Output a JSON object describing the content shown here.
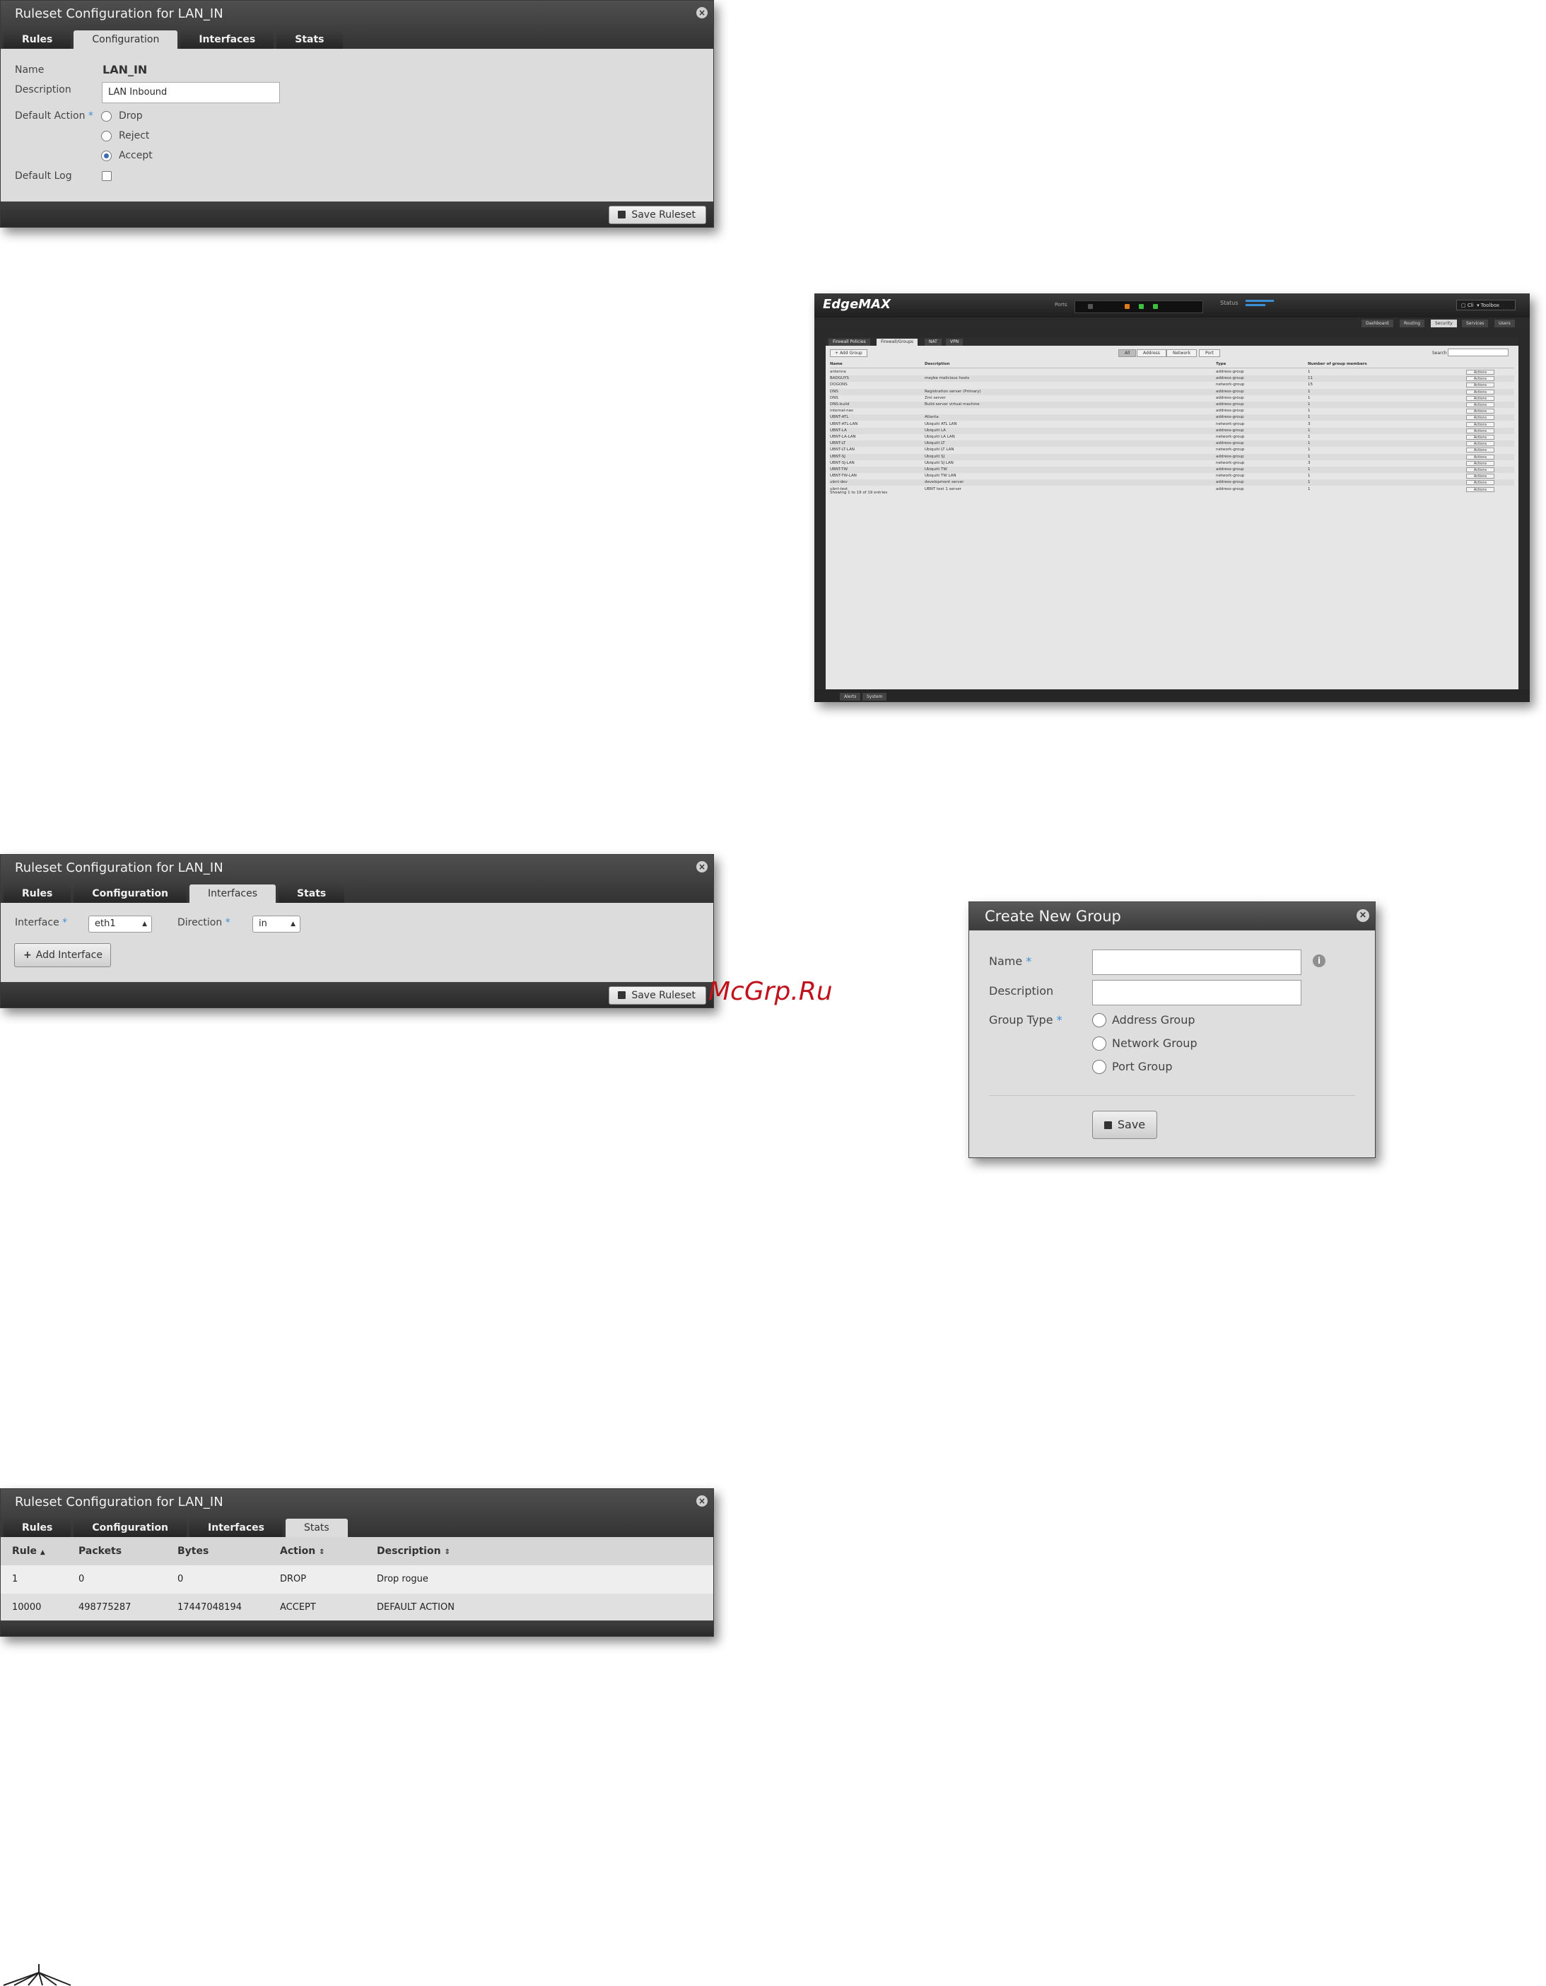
{
  "ruleset_title": "Ruleset Configuration for LAN_IN",
  "tabs": [
    "Rules",
    "Configuration",
    "Interfaces",
    "Stats"
  ],
  "save_ruleset_label": "Save Ruleset",
  "config": {
    "name_label": "Name",
    "name_value": "LAN_IN",
    "description_label": "Description",
    "description_value": "LAN Inbound",
    "default_action_label": "Default Action",
    "required_mark": "*",
    "actions": [
      "Drop",
      "Reject",
      "Accept"
    ],
    "selected_action": "Accept",
    "default_log_label": "Default Log"
  },
  "interfaces": {
    "interface_label": "Interface",
    "interface_value": "eth1",
    "direction_label": "Direction",
    "direction_value": "in",
    "add_interface_label": "Add Interface",
    "plus": "+"
  },
  "stats": {
    "columns": [
      "Rule",
      "Packets",
      "Bytes",
      "Action",
      "Description"
    ],
    "rows": [
      [
        "1",
        "0",
        "0",
        "DROP",
        "Drop rogue"
      ],
      [
        "10000",
        "498775287",
        "17447048194",
        "ACCEPT",
        "DEFAULT ACTION"
      ]
    ]
  },
  "create_group": {
    "title": "Create New Group",
    "name_label": "Name",
    "description_label": "Description",
    "group_type_label": "Group Type",
    "types": [
      "Address Group",
      "Network Group",
      "Port Group"
    ],
    "save_label": "Save",
    "required_mark": "*"
  },
  "edgemax": {
    "logo": "EdgeMAX",
    "ports_label": "Ports",
    "status_label": "Status",
    "nav_tabs": [
      "Dashboard",
      "Routing",
      "Security",
      "Services",
      "Users"
    ],
    "sub_tabs": [
      "Firewall Policies",
      "Firewall/Groups",
      "NAT",
      "VPN"
    ],
    "add_group": "Add Group",
    "filters": [
      "All",
      "Address",
      "Network",
      "Port"
    ],
    "search_label": "Search",
    "columns": [
      "Name",
      "Description",
      "Type",
      "Number of group members"
    ],
    "rows": [
      [
        "antenna",
        "",
        "address-group",
        "1"
      ],
      [
        "BADGUYS",
        "maybe malicious hosts",
        "address-group",
        "11"
      ],
      [
        "DOGONS",
        "",
        "network-group",
        "15"
      ],
      [
        "DNS",
        "Registration server (Primary)",
        "address-group",
        "1"
      ],
      [
        "DNS",
        "Zmi server",
        "address-group",
        "1"
      ],
      [
        "DNS-build",
        "Build server virtual machine",
        "address-group",
        "1"
      ],
      [
        "internal-nas",
        "",
        "address-group",
        "1"
      ],
      [
        "UBNT-ATL",
        "Atlanta",
        "address-group",
        "1"
      ],
      [
        "UBNT-ATL-LAN",
        "Ubiquiti ATL LAN",
        "network-group",
        "3"
      ],
      [
        "UBNT-LA",
        "Ubiquiti LA",
        "address-group",
        "1"
      ],
      [
        "UBNT-LA-LAN",
        "Ubiquiti LA LAN",
        "network-group",
        "1"
      ],
      [
        "UBNT-LT",
        "Ubiquiti LT",
        "address-group",
        "1"
      ],
      [
        "UBNT-LT-LAN",
        "Ubiquiti LT LAN",
        "network-group",
        "1"
      ],
      [
        "UBNT-SJ",
        "Ubiquiti SJ",
        "address-group",
        "1"
      ],
      [
        "UBNT-SJ-LAN",
        "Ubiquiti SJ LAN",
        "network-group",
        "3"
      ],
      [
        "UBNT-TW",
        "Ubiquiti TW",
        "address-group",
        "1"
      ],
      [
        "UBNT-TW-LAN",
        "Ubiquiti TW LAN",
        "network-group",
        "1"
      ],
      [
        "ubnt-dev",
        "development server",
        "address-group",
        "1"
      ],
      [
        "ubnt-test",
        "UBNT test 1 server",
        "address-group",
        "1"
      ]
    ],
    "actions_label": "Actions",
    "showing": "Showing 1 to 19 of 19 entries",
    "footer_tabs": [
      "Alerts",
      "System"
    ]
  },
  "watermark": "McGrp.Ru"
}
